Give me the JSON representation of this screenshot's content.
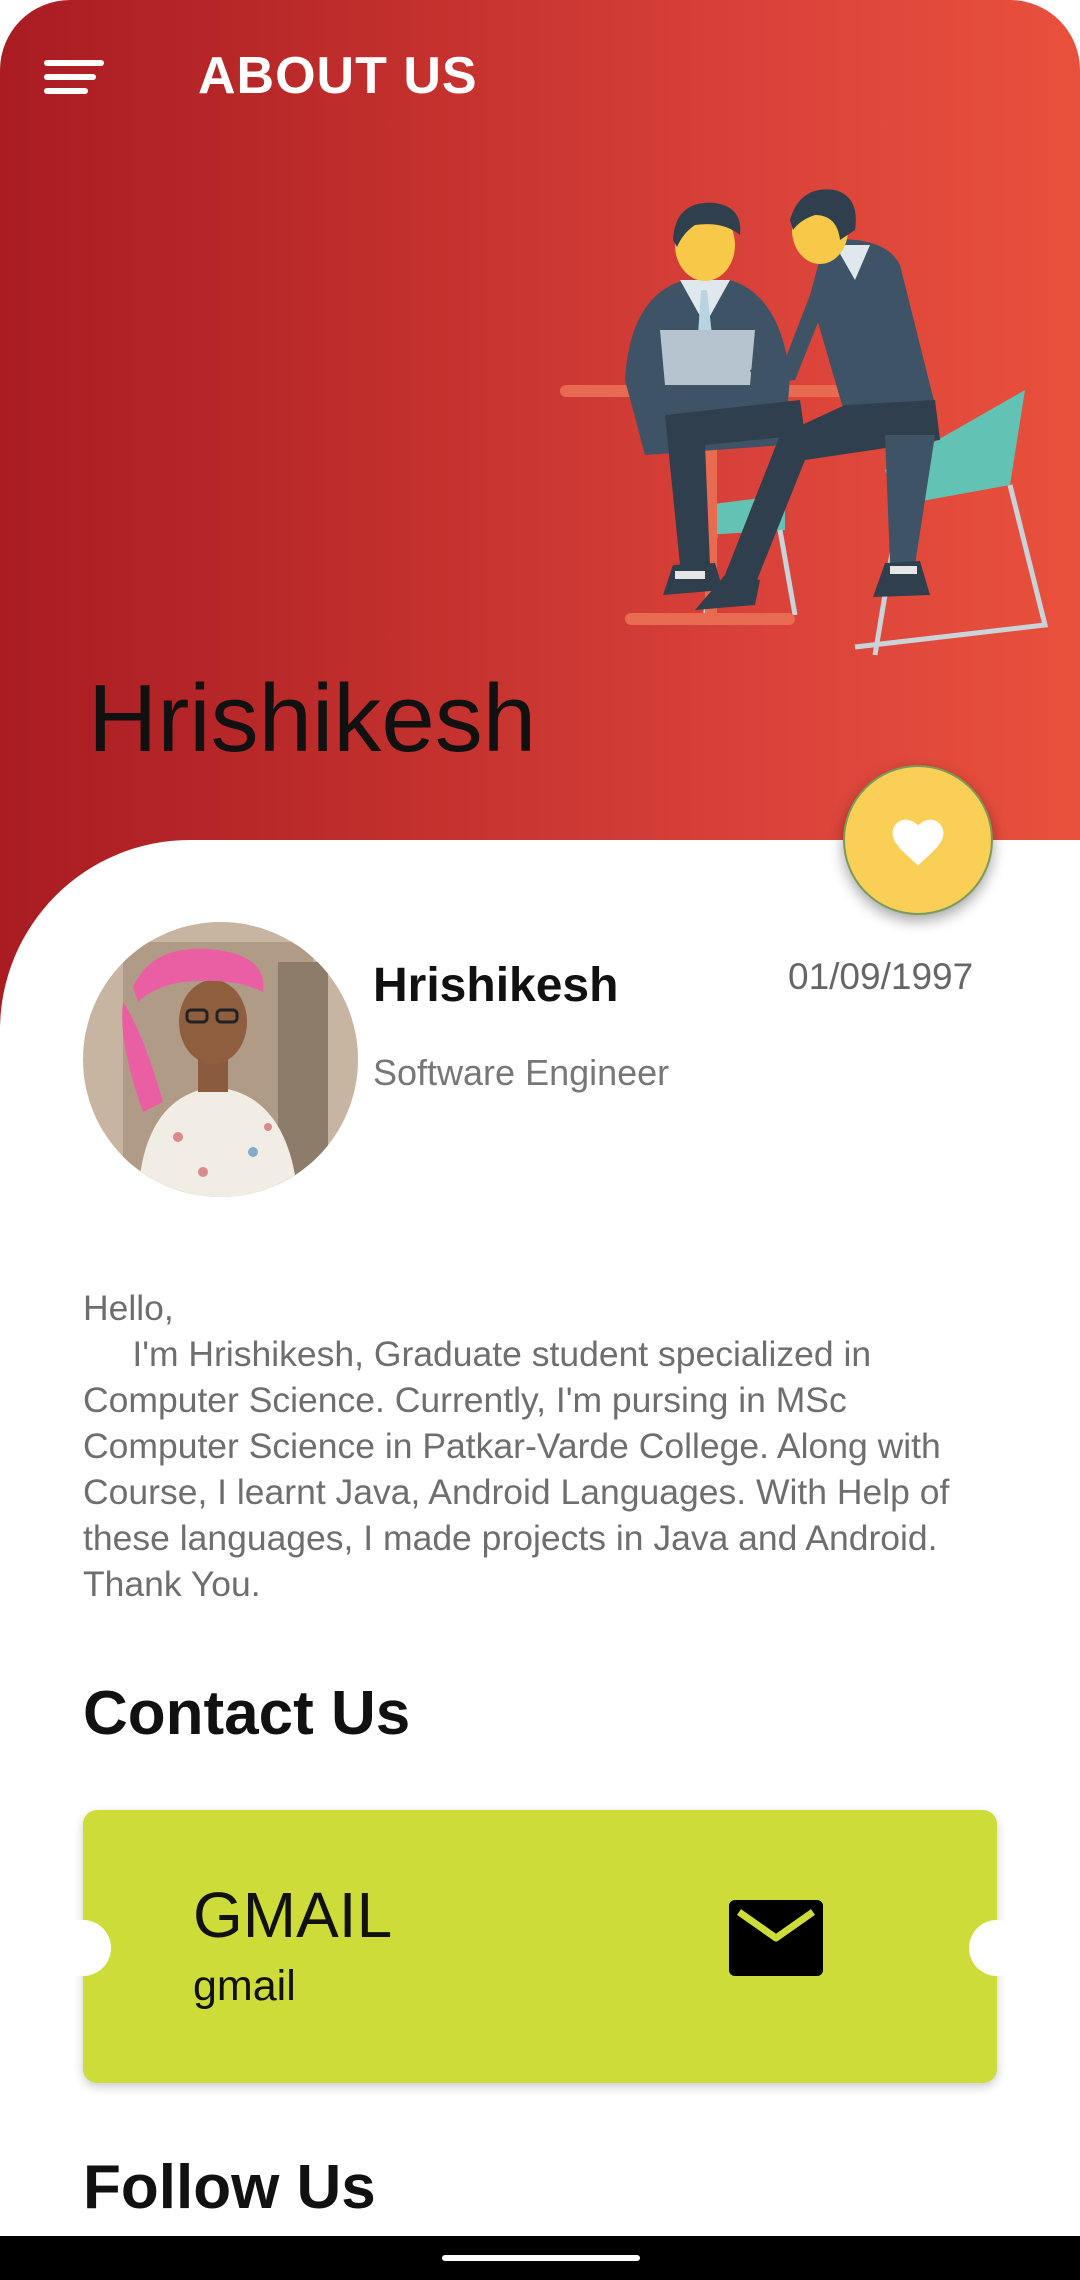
{
  "app_bar": {
    "title": "ABOUT US"
  },
  "hero": {
    "name": "Hrishikesh"
  },
  "profile": {
    "name": "Hrishikesh",
    "role": "Software Engineer",
    "date": "01/09/1997"
  },
  "bio": "Hello,\n     I'm Hrishikesh, Graduate student specialized in Computer Science. Currently, I'm pursing in MSc Computer Science in Patkar-Varde College. Along with Course, I learnt Java, Android Languages. With Help of these languages, I made projects in Java and Android. Thank You.",
  "contact": {
    "section_title": "Contact Us",
    "card_title": "GMAIL",
    "card_subtitle": "gmail",
    "icon": "mail-icon"
  },
  "follow": {
    "section_title": "Follow Us"
  },
  "colors": {
    "header_start": "#a91c22",
    "header_end": "#e9503c",
    "fab": "#f9cf55",
    "contact_card": "#cddc39"
  }
}
